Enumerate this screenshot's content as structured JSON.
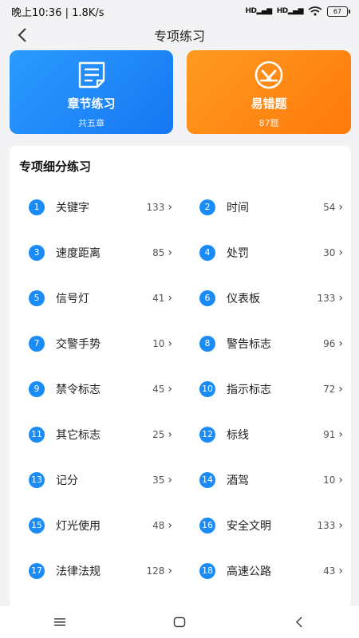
{
  "status": {
    "time_speed": "晚上10:36 | 1.8K/s",
    "sig1": "HD",
    "sig2": "HD",
    "battery": "67"
  },
  "header": {
    "title": "专项练习"
  },
  "cards": [
    {
      "title": "章节练习",
      "subtitle": "共五章",
      "icon": "document-icon",
      "color": "#1e88f5"
    },
    {
      "title": "易错题",
      "subtitle": "87题",
      "icon": "x-circle-icon",
      "color": "#ff8a14"
    }
  ],
  "section": {
    "title": "专项细分练习",
    "items": [
      {
        "num": "1",
        "label": "关键字",
        "count": "133"
      },
      {
        "num": "2",
        "label": "时间",
        "count": "54"
      },
      {
        "num": "3",
        "label": "速度距离",
        "count": "85"
      },
      {
        "num": "4",
        "label": "处罚",
        "count": "30"
      },
      {
        "num": "5",
        "label": "信号灯",
        "count": "41"
      },
      {
        "num": "6",
        "label": "仪表板",
        "count": "133"
      },
      {
        "num": "7",
        "label": "交警手势",
        "count": "10"
      },
      {
        "num": "8",
        "label": "警告标志",
        "count": "96"
      },
      {
        "num": "9",
        "label": "禁令标志",
        "count": "45"
      },
      {
        "num": "10",
        "label": "指示标志",
        "count": "72"
      },
      {
        "num": "11",
        "label": "其它标志",
        "count": "25"
      },
      {
        "num": "12",
        "label": "标线",
        "count": "91"
      },
      {
        "num": "13",
        "label": "记分",
        "count": "35"
      },
      {
        "num": "14",
        "label": "酒驾",
        "count": "10"
      },
      {
        "num": "15",
        "label": "灯光使用",
        "count": "48"
      },
      {
        "num": "16",
        "label": "安全文明",
        "count": "133"
      },
      {
        "num": "17",
        "label": "法律法规",
        "count": "128"
      },
      {
        "num": "18",
        "label": "高速公路",
        "count": "43"
      }
    ]
  },
  "colors": {
    "accent_blue": "#1b8cf7",
    "accent_orange": "#ff8a14",
    "background": "#f3f3f5"
  }
}
